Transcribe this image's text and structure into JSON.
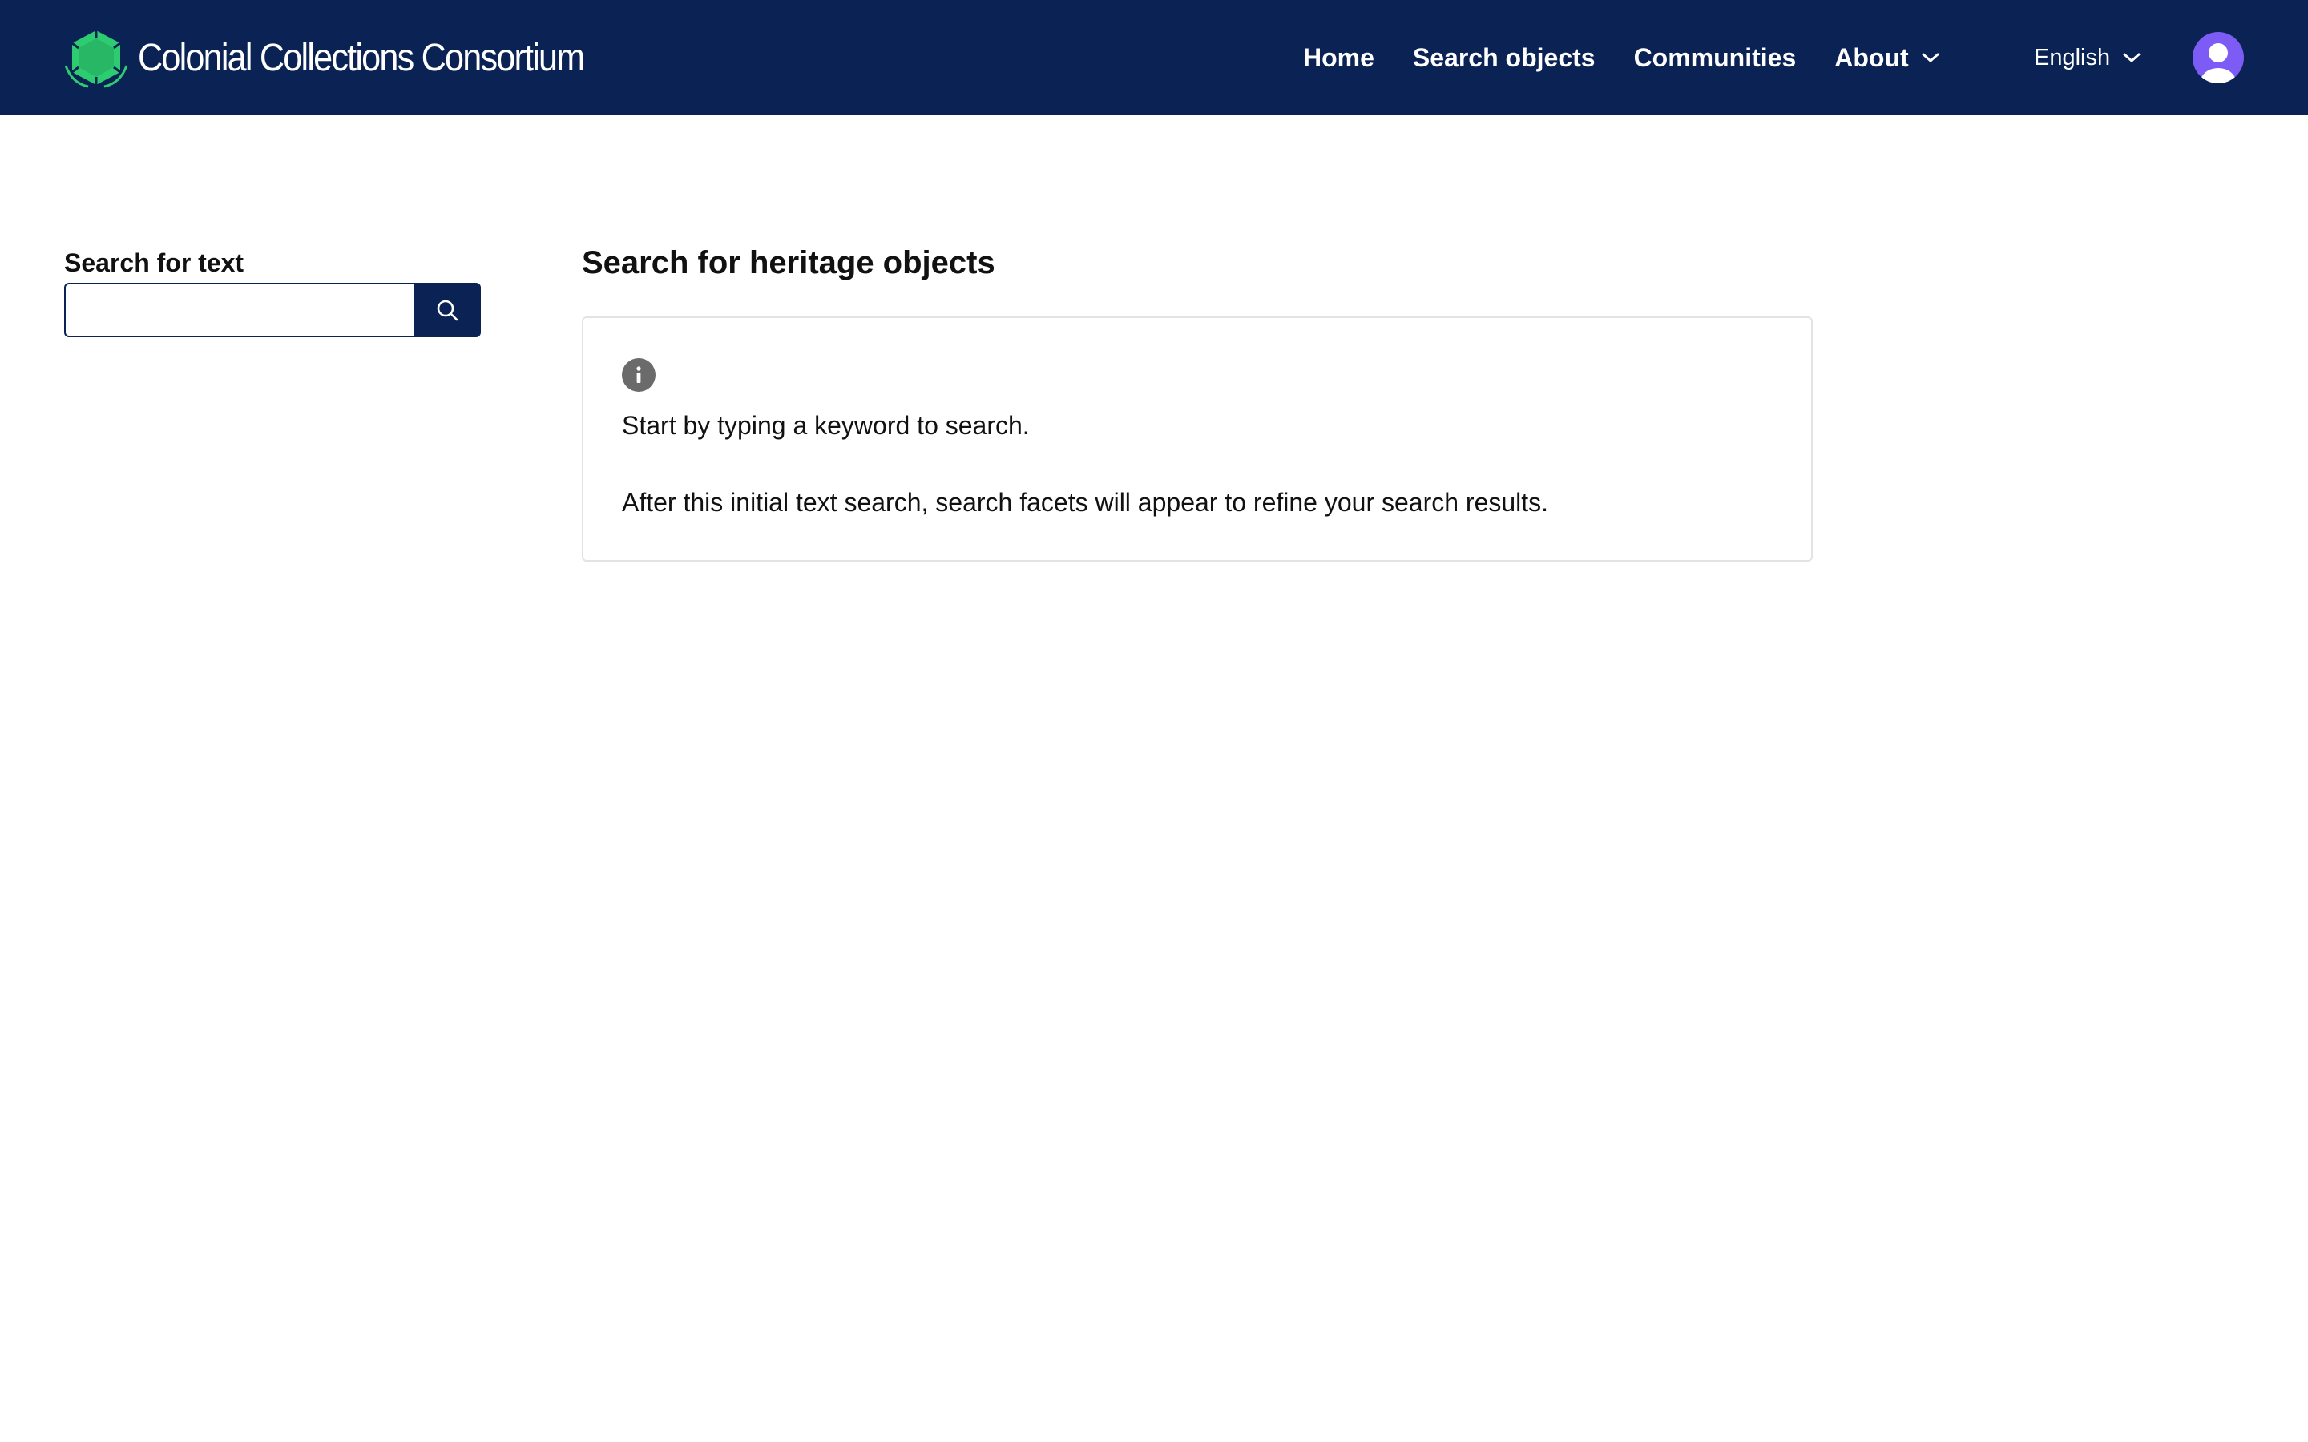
{
  "header": {
    "brand_name": "Colonial Collections Consortium",
    "nav": {
      "home": "Home",
      "search_objects": "Search objects",
      "communities": "Communities",
      "about": "About"
    },
    "language": "English"
  },
  "sidebar": {
    "search_label": "Search for text",
    "search_value": ""
  },
  "main": {
    "title": "Search for heritage objects",
    "info": {
      "line1": "Start by typing a keyword to search.",
      "line2": "After this initial text search, search facets will appear to refine your search results."
    }
  },
  "icons": {
    "logo": "hexagon-leaf-logo-icon",
    "about_dropdown": "chevron-down-icon",
    "language_dropdown": "chevron-down-icon",
    "avatar": "user-avatar-icon",
    "search": "search-icon",
    "info": "info-icon"
  },
  "colors": {
    "header_bg": "#0a2254",
    "logo_green": "#2ecc71",
    "avatar_bg": "#7c5cf5",
    "info_icon": "#6b6b6b",
    "box_border": "#e3e3e3"
  }
}
